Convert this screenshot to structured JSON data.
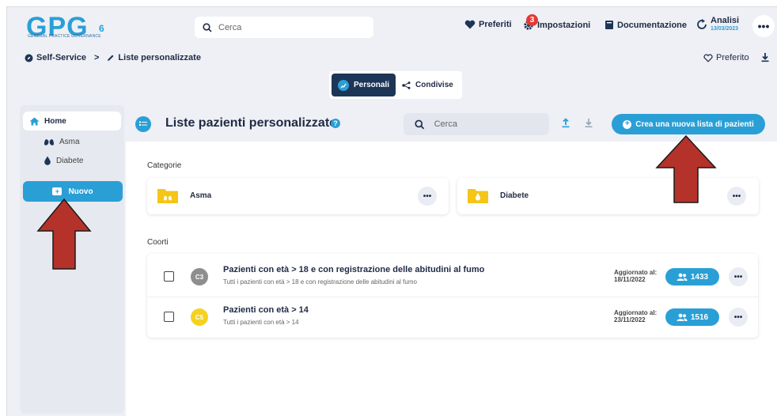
{
  "colors": {
    "accent": "#2a9fd6",
    "dark": "#1d3557",
    "badge": "#e53935",
    "folder": "#f5c518",
    "arrow": "#b5322a"
  },
  "logo": {
    "text": "GPG",
    "subtitle": "GENERAL PRACTICE GOVERNANCE",
    "version": "6"
  },
  "topbar": {
    "search_placeholder": "Cerca",
    "preferiti": "Preferiti",
    "impostazioni": "Impostazioni",
    "impostazioni_badge": "3",
    "documentazione": "Documentazione",
    "analisi_label": "Analisi",
    "analisi_date": "13/03/2023",
    "more": "•••"
  },
  "breadcrumb": {
    "root": "Self-Service",
    "separator": ">",
    "current": "Liste personalizzate"
  },
  "page_actions": {
    "preferito": "Preferito"
  },
  "tabs": [
    {
      "label": "Personali",
      "active": true
    },
    {
      "label": "Condivise",
      "active": false
    }
  ],
  "sidebar": {
    "home": "Home",
    "items": [
      {
        "label": "Asma",
        "icon": "lungs-icon"
      },
      {
        "label": "Diabete",
        "icon": "drop-icon"
      }
    ],
    "new_button": "Nuovo"
  },
  "main": {
    "title": "Liste pazienti personalizzate",
    "search_placeholder": "Cerca",
    "create_button": "Crea una nuova lista di pazienti",
    "categories_label": "Categorie",
    "categories": [
      {
        "name": "Asma",
        "more": "•••"
      },
      {
        "name": "Diabete",
        "more": "•••"
      }
    ],
    "cohorts_label": "Coorti",
    "cohorts": [
      {
        "avatar": "C3",
        "avatar_color": "#8e8e8e",
        "title": "Pazienti con età > 18 e con registrazione delle abitudini al fumo",
        "description": "Tutti i pazienti con età > 18 e con registrazione delle abitudini al fumo",
        "updated_label": "Aggiornato al:",
        "updated_date": "18/11/2022",
        "count": "1433",
        "more": "•••"
      },
      {
        "avatar": "C5",
        "avatar_color": "#f5d21f",
        "title": "Pazienti con età > 14",
        "description": "Tutti i pazienti con età > 14",
        "updated_label": "Aggiornato al:",
        "updated_date": "23/11/2022",
        "count": "1516",
        "more": "•••"
      }
    ]
  }
}
